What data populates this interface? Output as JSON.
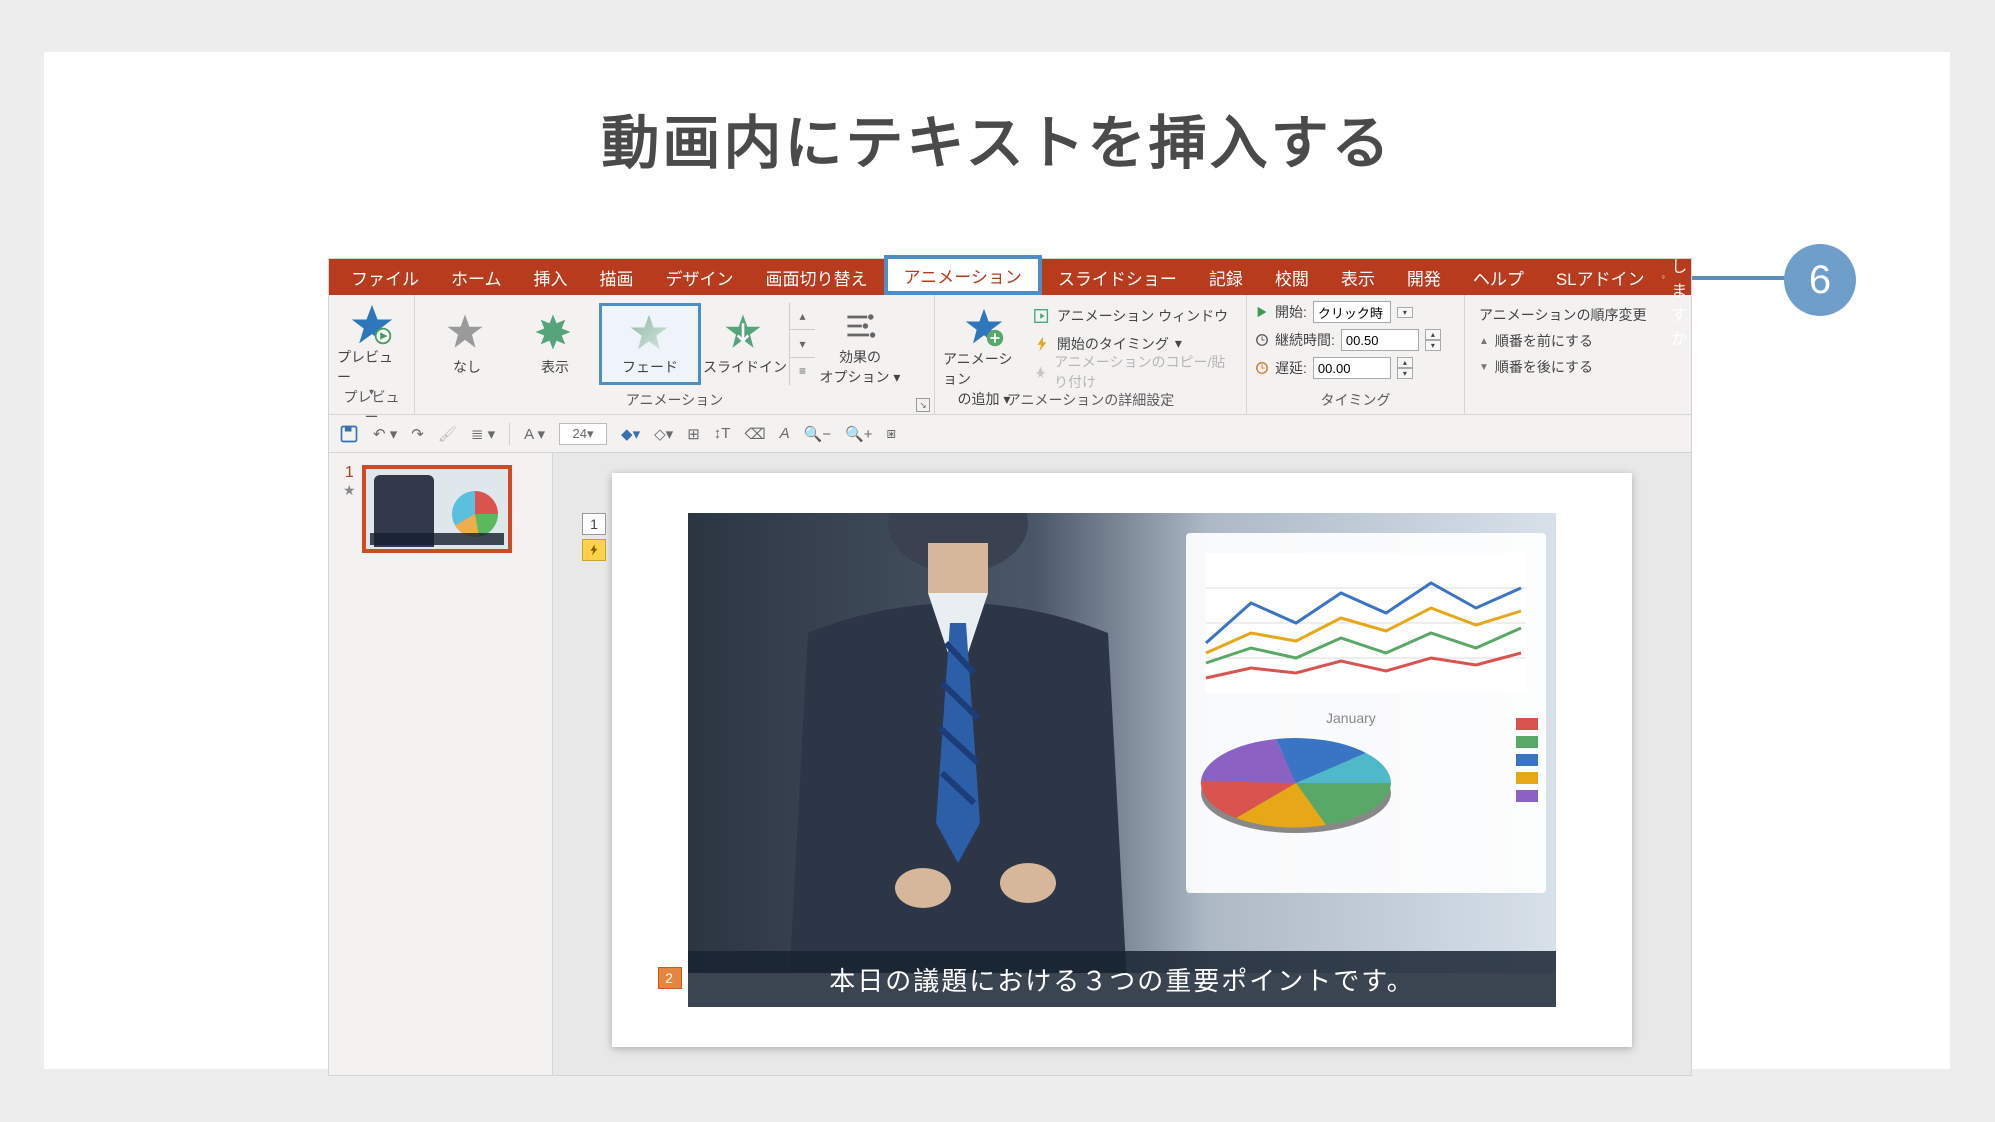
{
  "page": {
    "heading": "動画内にテキストを挿入する"
  },
  "callout": {
    "number": "6"
  },
  "ribbon": {
    "tabs": [
      "ファイル",
      "ホーム",
      "挿入",
      "描画",
      "デザイン",
      "画面切り替え",
      "アニメーション",
      "スライドショー",
      "記録",
      "校閲",
      "表示",
      "開発",
      "ヘルプ",
      "SLアドイン"
    ],
    "active_index": 6,
    "help_prompt": "何をしますか"
  },
  "preview_group": {
    "label": "プレビュー",
    "button": "プレビュー"
  },
  "animation_group": {
    "label": "アニメーション",
    "items": [
      {
        "label": "なし"
      },
      {
        "label": "表示"
      },
      {
        "label": "フェード",
        "selected": true
      },
      {
        "label": "スライドイン"
      }
    ],
    "options_button": {
      "line1": "効果の",
      "line2": "オプション"
    }
  },
  "advanced_group": {
    "label": "アニメーションの詳細設定",
    "add_button": {
      "line1": "アニメーション",
      "line2": "の追加"
    },
    "pane": "アニメーション ウィンドウ",
    "trigger": "開始のタイミング",
    "painter": "アニメーションのコピー/貼り付け"
  },
  "timing_group": {
    "label": "タイミング",
    "start_label": "開始:",
    "start_value": "クリック時",
    "duration_label": "継続時間:",
    "duration_value": "00.50",
    "delay_label": "遅延:",
    "delay_value": "00.00"
  },
  "reorder_group": {
    "header": "アニメーションの順序変更",
    "earlier": "順番を前にする",
    "later": "順番を後にする"
  },
  "qat": {
    "font_size": "24"
  },
  "thumbs": {
    "slide1_number": "1"
  },
  "slide": {
    "tag1": "1",
    "caption_tag": "2",
    "caption_text": "本日の議題における３つの重要ポイントです。"
  }
}
